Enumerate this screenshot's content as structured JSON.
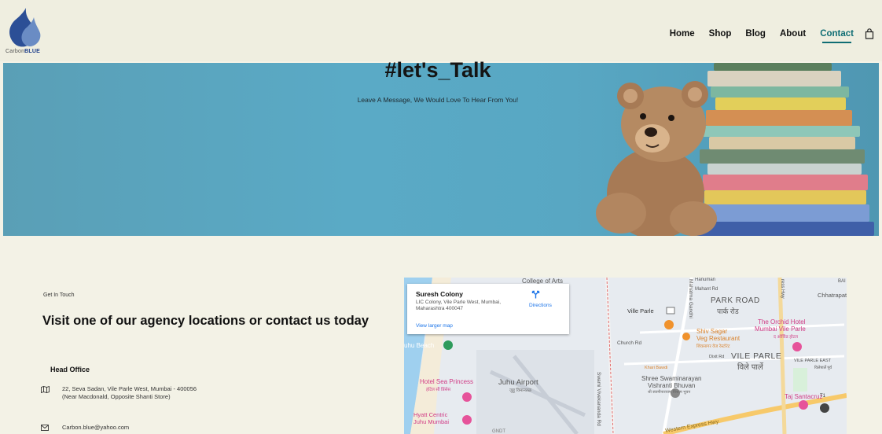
{
  "brand": {
    "logo_text_light": "Carbon",
    "logo_text_bold": "BLUE"
  },
  "nav": {
    "items": [
      {
        "label": "Home"
      },
      {
        "label": "Shop"
      },
      {
        "label": "Blog"
      },
      {
        "label": "About"
      },
      {
        "label": "Contact",
        "active": true
      }
    ],
    "cart_icon": "shopping-bag-icon"
  },
  "hero": {
    "title": "#let's_Talk",
    "subtitle": "Leave A Message, We Would Love To Hear From You!"
  },
  "contact": {
    "eyebrow": "Get In Touch",
    "heading": "Visit one of our agency locations or contact us today",
    "office_title": "Head Office",
    "address": "22, Seva Sadan, Vile Parle West, Mumbai - 400056 (Near Macdonald, Opposite Shanti Store)",
    "email": "Carbon.blue@yahoo.com"
  },
  "map": {
    "card": {
      "title": "Suresh Colony",
      "address": "LIC Colony, Vile Parle West, Mumbai, Maharashtra 400047",
      "directions_label": "Directions",
      "larger_map_label": "View larger map"
    },
    "labels": {
      "college": "College of Arts",
      "juhu_beach": "uhu Beach",
      "hotel_sea_princess": "Hotel Sea Princess",
      "hotel_sea_princess_local": "हॉटेल सी प्रिंसेस",
      "juhu_airport": "Juhu Airport",
      "juhu_airport_local": "जुहू विमानतळ",
      "hyatt_1": "Hyatt Centric",
      "hyatt_2": "Juhu Mumbai",
      "vile_parle_station": "Ville Parle",
      "church_rd": "Church Rd",
      "swami_rd": "Swami Vivekananda Rd",
      "mahatma": "Mahatma Gandhi",
      "park_road": "PARK ROAD",
      "park_road_local": "पार्क रोड",
      "shiv_sagar_1": "Shiv Sagar",
      "shiv_sagar_2": "Veg Restaurant",
      "shiv_sagar_local": "शिवसागर वेज रेस्टॉरंट",
      "orchid_1": "The Orchid Hotel",
      "orchid_2": "Mumbai Vile Parle",
      "orchid_local": "द ऑर्किड होटल",
      "vile_parle": "VILE PARLE",
      "vile_parle_local": "विले पार्ले",
      "vile_parle_east": "VILE PARLE EAST",
      "vile_parle_east_local": "विलेपार्ले पूर्व",
      "dixit_rd": "Dixit Rd",
      "khari_bawdi": "Khari Bawdi",
      "shree_1": "Shree Swaminarayan",
      "shree_2": "Vishranti Bhuvan",
      "shree_local": "श्री स्वामीनारायण विश्राम भुवन",
      "taj": "Taj Santacruz",
      "t1": "T1",
      "western_express": "Western Express Hwy",
      "chhatrapati": "Chhatrapat",
      "mahant": "Mahant Rd",
      "hanuman": "Hanuman",
      "gndt": "GNDT",
      "ba": "BAI",
      "express_hwy": "ress Hwy"
    }
  },
  "colors": {
    "accent": "#0f6d74",
    "background": "#f3f2e6",
    "hero": "#5aaac6"
  }
}
